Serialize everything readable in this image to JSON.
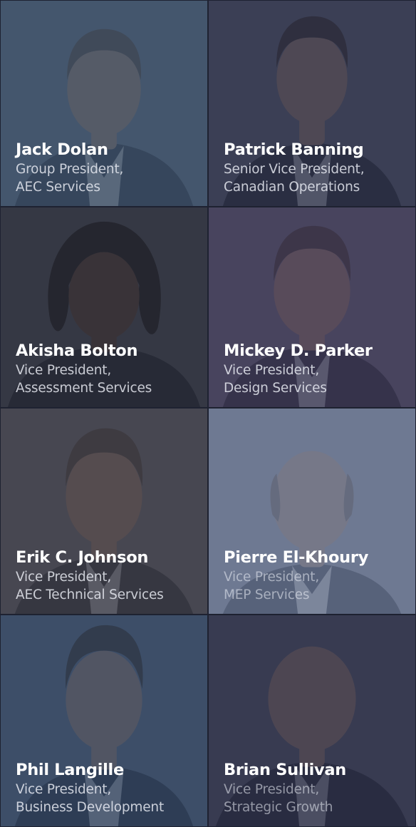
{
  "team": [
    {
      "name": "Jack Dolan",
      "title_line1": "Group President,",
      "title_line2": "AEC Services",
      "overlay_color": "#34465e",
      "bg_color": "#7c8fa4",
      "skin_color": "#c9a38a",
      "hair_color": "#6b5848",
      "suit_color": "#3c4656",
      "shirt_color": "#d8dde4"
    },
    {
      "name": "Patrick Banning",
      "title_line1": "Senior Vice President,",
      "title_line2": "Canadian Operations",
      "overlay_color": "#2d3146",
      "bg_color": "#6c7487",
      "skin_color": "#c49c86",
      "hair_color": "#3a2c26",
      "suit_color": "#232634",
      "shirt_color": "#cfd6e0"
    },
    {
      "name": "Akisha Bolton",
      "title_line1": "Vice President,",
      "title_line2": "Assessment Services",
      "overlay_color": "#2a2d38",
      "bg_color": "#5e6270",
      "skin_color": "#6e4a3a",
      "hair_color": "#14110f",
      "suit_color": "#1b2130",
      "shirt_color": "#2a3044"
    },
    {
      "name": "Mickey D. Parker",
      "title_line1": "Vice President,",
      "title_line2": "Design Services",
      "overlay_color": "#3a3650",
      "bg_color": "#7b7690",
      "skin_color": "#c4957e",
      "hair_color": "#4a3a32",
      "suit_color": "#2a2c3c",
      "shirt_color": "#c8cfdc"
    },
    {
      "name": "Erik C. Johnson",
      "title_line1": "Vice President,",
      "title_line2": "AEC Technical Services",
      "overlay_color": "#3a3a44",
      "bg_color": "#76767e",
      "skin_color": "#b78c76",
      "hair_color": "#4e4038",
      "suit_color": "#2c2e36",
      "shirt_color": "#c8ccd6"
    },
    {
      "name": "Pierre El-Khoury",
      "title_line1": "Vice President,",
      "title_line2": "MEP Services",
      "overlay_color": "#5f6a84",
      "bg_color": "#a3adc2",
      "skin_color": "#c9a898",
      "hair_color": "#7a6e68",
      "suit_color": "#3e4458",
      "shirt_color": "#e2e6ee"
    },
    {
      "name": "Phil Langille",
      "title_line1": "Vice President,",
      "title_line2": "Business Development",
      "overlay_color": "#2f4058",
      "bg_color": "#6e82a0",
      "skin_color": "#c9a088",
      "hair_color": "#3c2e28",
      "suit_color": "#2a3448",
      "shirt_color": "#d6dce6"
    },
    {
      "name": "Brian Sullivan",
      "title_line1": "Vice President,",
      "title_line2": "Strategic Growth",
      "overlay_color": "#2c2e44",
      "bg_color": "#666a80",
      "skin_color": "#c49a86",
      "hair_color": "#6a5a52",
      "suit_color": "#222436",
      "shirt_color": "#b9c0cc"
    }
  ]
}
